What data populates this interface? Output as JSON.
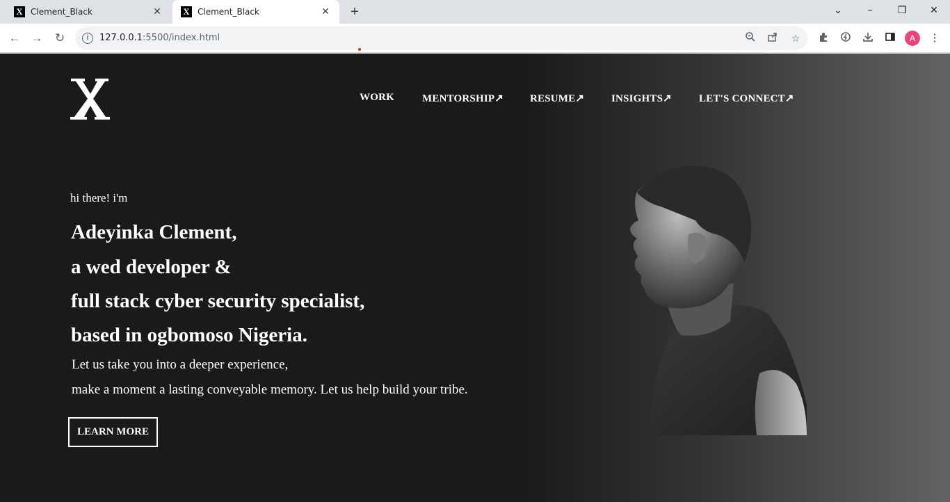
{
  "browser": {
    "tabs": [
      {
        "title": "Clement_Black",
        "favicon": "X",
        "active": false
      },
      {
        "title": "Clement_Black",
        "favicon": "X",
        "active": true
      }
    ],
    "url_host": "127.0.0.1",
    "url_path": ":5500/index.html",
    "profile_initial": "A"
  },
  "site": {
    "logo_letter": "X",
    "nav": [
      {
        "label": "WORK"
      },
      {
        "label": "MENTORSHIP↗"
      },
      {
        "label": "RESUME↗"
      },
      {
        "label": "INSIGHTS↗"
      },
      {
        "label": "LET'S CONNECT↗"
      }
    ],
    "hero": {
      "greeting": "hi there! i'm",
      "lines": [
        "Adeyinka Clement,",
        "a wed developer &",
        "full stack cyber security specialist,",
        "based in ogbomoso Nigeria."
      ],
      "sub_lines": [
        "Let us take you into a deeper experience,",
        "make a moment a lasting conveyable memory. Let us help build your tribe."
      ],
      "cta_label": "LEARN MORE"
    }
  },
  "colors": {
    "page_bg_dark": "#1a1a1a",
    "page_bg_light": "#636363",
    "text": "#ffffff",
    "avatar": "#e8467c"
  }
}
